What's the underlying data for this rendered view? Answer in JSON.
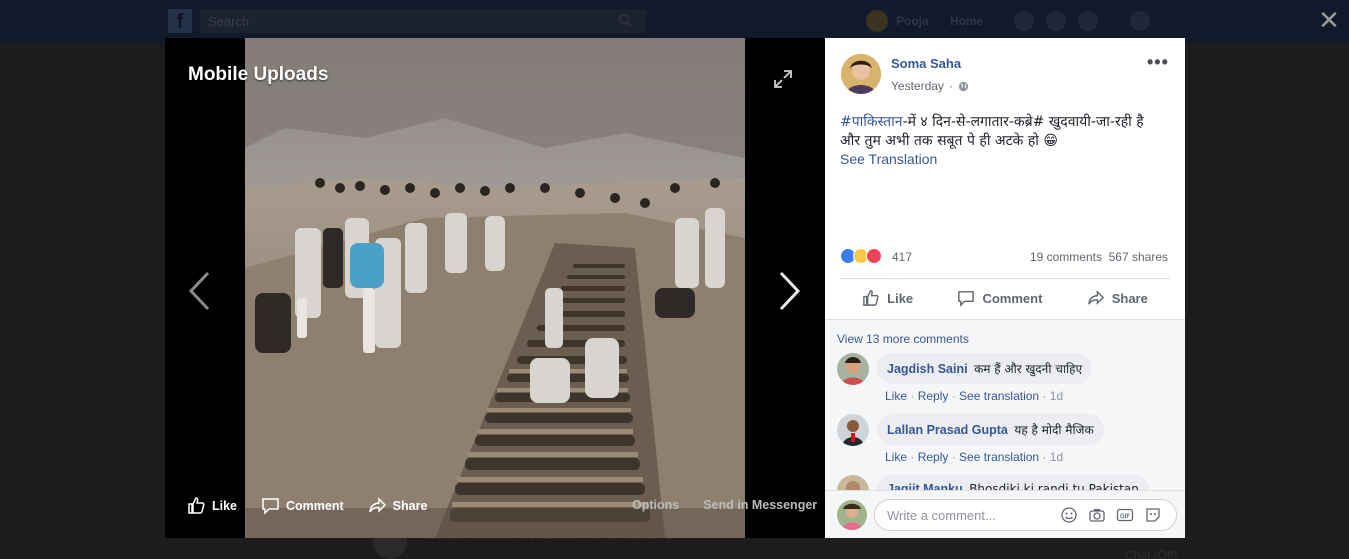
{
  "topbar": {
    "search_placeholder": "Search",
    "user_name": "Pooja",
    "home_label": "Home"
  },
  "background": {
    "post_text": "Sushant Kumar Jha shared a link. lol.. sakta hai",
    "chat_label": "Chat (Off)"
  },
  "photo_viewer": {
    "album_title": "Mobile Uploads",
    "actions": {
      "like": "Like",
      "comment": "Comment",
      "share": "Share"
    },
    "options_label": "Options",
    "messenger_label": "Send in Messenger"
  },
  "post": {
    "author": "Soma Saha",
    "time": "Yesterday",
    "hashtag": "#पाकिस्तान",
    "text_part1": "-में ४ दिन-से-लगातार-कब्रे# खुदवायी-जा-रही है",
    "text_part2": "और तुम अभी तक सबूत पे ही अटके हो 😁",
    "see_translation": "See Translation",
    "reaction_count": "417",
    "comments_count": "19 comments",
    "shares_count": "567 shares",
    "actions": {
      "like": "Like",
      "comment": "Comment",
      "share": "Share"
    }
  },
  "comments": {
    "view_more": "View 13 more comments",
    "items": [
      {
        "name": "Jagdish Saini",
        "text": "कम हैं और खुदनी चाहिए",
        "like": "Like",
        "reply": "Reply",
        "translate": "See translation",
        "time": "1d"
      },
      {
        "name": "Lallan Prasad Gupta",
        "text": "यह है मोदी मैजिक",
        "like": "Like",
        "reply": "Reply",
        "translate": "See translation",
        "time": "1d"
      },
      {
        "name": "Jagjit Manku",
        "text": "Bhosdiki ki randi tu Pakistan"
      }
    ]
  },
  "composer": {
    "placeholder": "Write a comment..."
  },
  "colors": {
    "link": "#365899",
    "stage": "#000000",
    "panel": "#ffffff"
  }
}
